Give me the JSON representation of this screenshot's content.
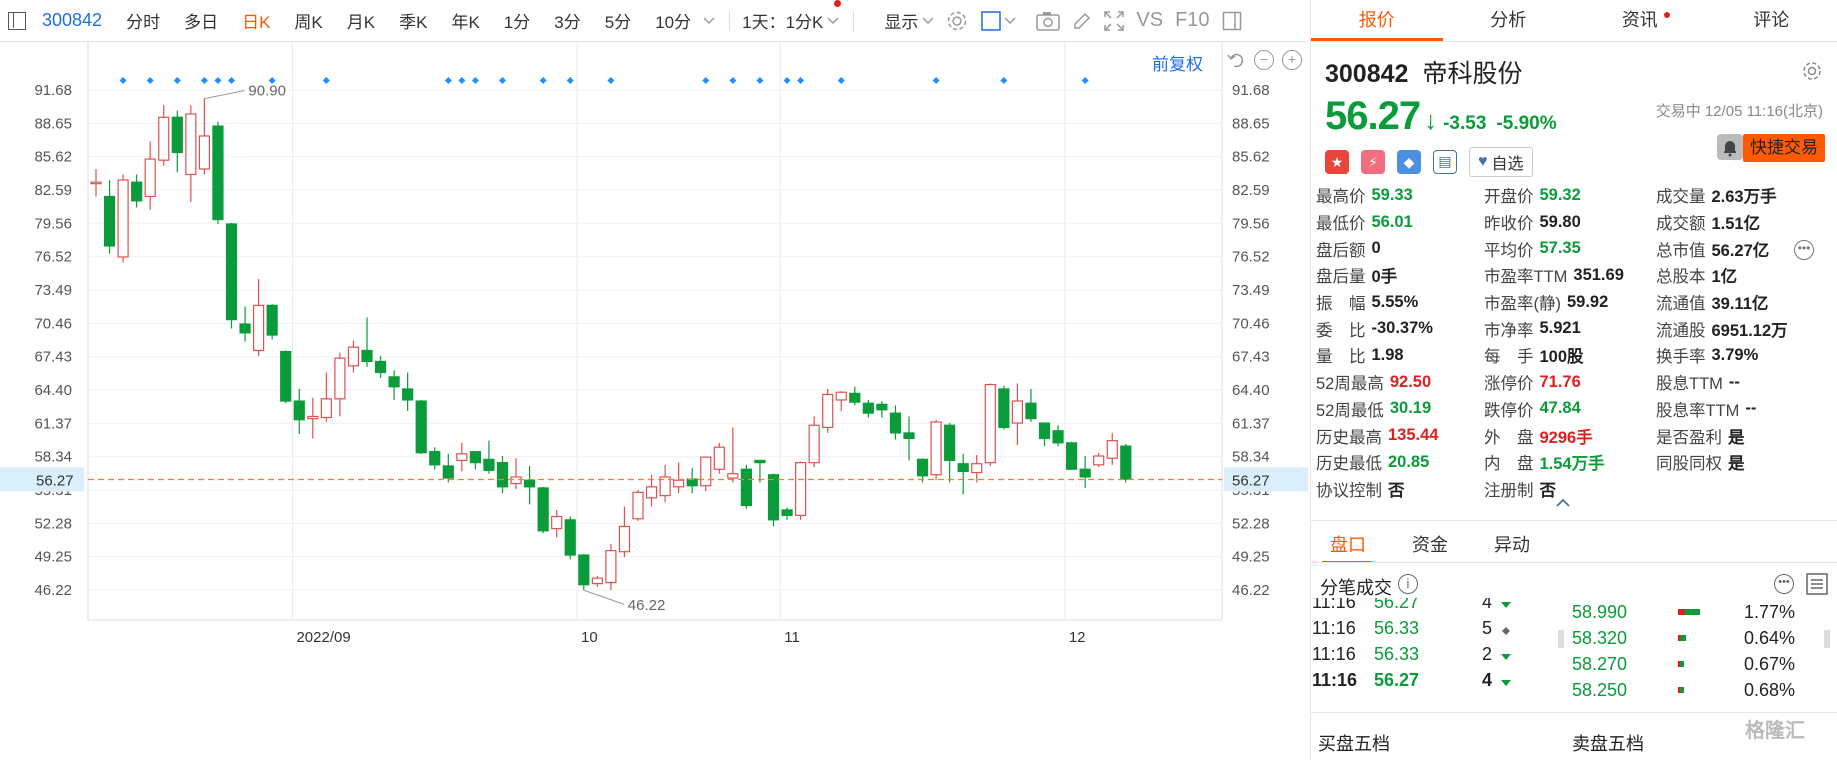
{
  "toolbar": {
    "code": "300842",
    "periods": [
      "分时",
      "多日",
      "日K",
      "周K",
      "月K",
      "季K",
      "年K",
      "1分",
      "3分",
      "5分",
      "10分"
    ],
    "active_period": "日K",
    "timeframe_select": "1天：1分K",
    "display_label": "显示",
    "vs_label": "VS",
    "f10_label": "F10"
  },
  "chart": {
    "fq_label": "前复权",
    "current_price_tag": "56.27",
    "high_label": "90.90",
    "low_label": "46.22",
    "colors": {
      "up": "#e05050",
      "down": "#0a9b3a",
      "price_line": "#ff7b2e",
      "marker": "#1e90ff"
    }
  },
  "chart_data": {
    "type": "candlestick",
    "y_ticks": [
      "91.68",
      "88.65",
      "85.62",
      "82.59",
      "79.56",
      "76.52",
      "73.49",
      "70.46",
      "67.43",
      "64.40",
      "61.37",
      "58.34",
      "55.31",
      "52.28",
      "49.25",
      "46.22"
    ],
    "ylim": [
      43.19,
      94.71
    ],
    "x_labels": [
      {
        "label": "2022/09",
        "index": 15
      },
      {
        "label": "10",
        "index": 36
      },
      {
        "label": "11",
        "index": 51
      },
      {
        "label": "12",
        "index": 72
      }
    ],
    "candles": [
      {
        "o": 83.3,
        "c": 83.3,
        "h": 84.5,
        "l": 82.0
      },
      {
        "o": 82.0,
        "c": 77.5,
        "h": 83.5,
        "l": 76.8
      },
      {
        "o": 76.5,
        "c": 83.5,
        "h": 84.0,
        "l": 76.0
      },
      {
        "o": 83.3,
        "c": 81.6,
        "h": 84.0,
        "l": 81.0
      },
      {
        "o": 82.0,
        "c": 85.4,
        "h": 87.0,
        "l": 80.8
      },
      {
        "o": 85.3,
        "c": 89.2,
        "h": 90.3,
        "l": 84.8
      },
      {
        "o": 89.2,
        "c": 86.0,
        "h": 89.8,
        "l": 84.2
      },
      {
        "o": 84.0,
        "c": 89.5,
        "h": 90.3,
        "l": 81.5
      },
      {
        "o": 84.5,
        "c": 87.5,
        "h": 90.9,
        "l": 84.0
      },
      {
        "o": 88.4,
        "c": 79.9,
        "h": 88.8,
        "l": 79.5
      },
      {
        "o": 79.5,
        "c": 70.8,
        "h": 79.6,
        "l": 70.0
      },
      {
        "o": 70.4,
        "c": 69.6,
        "h": 72.0,
        "l": 68.8
      },
      {
        "o": 68.0,
        "c": 72.1,
        "h": 74.5,
        "l": 67.5
      },
      {
        "o": 72.1,
        "c": 69.4,
        "h": 72.2,
        "l": 69.0
      },
      {
        "o": 67.9,
        "c": 63.4,
        "h": 68.0,
        "l": 63.2
      },
      {
        "o": 63.4,
        "c": 61.7,
        "h": 64.5,
        "l": 60.4
      },
      {
        "o": 61.8,
        "c": 62.0,
        "h": 63.7,
        "l": 60.0
      },
      {
        "o": 61.9,
        "c": 63.6,
        "h": 66.0,
        "l": 61.5
      },
      {
        "o": 63.6,
        "c": 67.3,
        "h": 67.8,
        "l": 62.0
      },
      {
        "o": 66.6,
        "c": 68.3,
        "h": 68.9,
        "l": 66.0
      },
      {
        "o": 68.0,
        "c": 67.0,
        "h": 71.0,
        "l": 66.5
      },
      {
        "o": 67.0,
        "c": 66.0,
        "h": 67.5,
        "l": 65.5
      },
      {
        "o": 65.6,
        "c": 64.7,
        "h": 66.2,
        "l": 63.5
      },
      {
        "o": 64.5,
        "c": 63.5,
        "h": 66.0,
        "l": 62.5
      },
      {
        "o": 63.4,
        "c": 58.7,
        "h": 63.5,
        "l": 58.6
      },
      {
        "o": 58.8,
        "c": 57.6,
        "h": 59.2,
        "l": 57.2
      },
      {
        "o": 57.5,
        "c": 56.4,
        "h": 58.6,
        "l": 56.0
      },
      {
        "o": 58.0,
        "c": 58.6,
        "h": 59.6,
        "l": 57.0
      },
      {
        "o": 58.8,
        "c": 57.8,
        "h": 58.7,
        "l": 57.2
      },
      {
        "o": 58.1,
        "c": 57.1,
        "h": 59.8,
        "l": 56.8
      },
      {
        "o": 57.8,
        "c": 55.6,
        "h": 58.4,
        "l": 55.0
      },
      {
        "o": 55.9,
        "c": 56.5,
        "h": 58.2,
        "l": 55.4
      },
      {
        "o": 56.2,
        "c": 55.6,
        "h": 57.5,
        "l": 54.0
      },
      {
        "o": 55.5,
        "c": 51.6,
        "h": 55.6,
        "l": 51.4
      },
      {
        "o": 51.8,
        "c": 52.9,
        "h": 53.5,
        "l": 51.0
      },
      {
        "o": 52.6,
        "c": 49.4,
        "h": 52.9,
        "l": 49.0
      },
      {
        "o": 49.4,
        "c": 46.7,
        "h": 49.5,
        "l": 46.2
      },
      {
        "o": 46.8,
        "c": 47.3,
        "h": 47.5,
        "l": 46.5
      },
      {
        "o": 46.9,
        "c": 49.8,
        "h": 50.4,
        "l": 46.2
      },
      {
        "o": 49.7,
        "c": 52.0,
        "h": 53.8,
        "l": 49.2
      },
      {
        "o": 52.7,
        "c": 55.1,
        "h": 55.3,
        "l": 52.5
      },
      {
        "o": 54.6,
        "c": 55.6,
        "h": 56.7,
        "l": 53.8
      },
      {
        "o": 54.8,
        "c": 56.5,
        "h": 57.6,
        "l": 54.2
      },
      {
        "o": 55.6,
        "c": 56.2,
        "h": 57.8,
        "l": 55.0
      },
      {
        "o": 56.3,
        "c": 55.7,
        "h": 57.3,
        "l": 55.0
      },
      {
        "o": 55.7,
        "c": 58.3,
        "h": 58.3,
        "l": 55.2
      },
      {
        "o": 57.2,
        "c": 59.2,
        "h": 59.6,
        "l": 56.8
      },
      {
        "o": 56.4,
        "c": 56.8,
        "h": 61.0,
        "l": 56.0
      },
      {
        "o": 57.2,
        "c": 53.9,
        "h": 57.6,
        "l": 53.6
      },
      {
        "o": 58.0,
        "c": 57.8,
        "h": 58.0,
        "l": 56.0
      },
      {
        "o": 56.7,
        "c": 52.6,
        "h": 56.8,
        "l": 52.0
      },
      {
        "o": 53.5,
        "c": 53.0,
        "h": 53.7,
        "l": 52.6
      },
      {
        "o": 53.0,
        "c": 57.8,
        "h": 57.9,
        "l": 52.6
      },
      {
        "o": 57.8,
        "c": 61.2,
        "h": 62.0,
        "l": 57.4
      },
      {
        "o": 61.0,
        "c": 64.0,
        "h": 64.5,
        "l": 60.5
      },
      {
        "o": 63.5,
        "c": 64.2,
        "h": 64.3,
        "l": 62.5
      },
      {
        "o": 64.1,
        "c": 63.3,
        "h": 64.7,
        "l": 63.0
      },
      {
        "o": 63.2,
        "c": 62.3,
        "h": 63.5,
        "l": 61.9
      },
      {
        "o": 63.1,
        "c": 62.6,
        "h": 63.4,
        "l": 61.9
      },
      {
        "o": 62.3,
        "c": 60.5,
        "h": 63.0,
        "l": 59.9
      },
      {
        "o": 60.5,
        "c": 60.0,
        "h": 62.0,
        "l": 58.0
      },
      {
        "o": 58.1,
        "c": 56.6,
        "h": 58.2,
        "l": 56.0
      },
      {
        "o": 56.7,
        "c": 61.5,
        "h": 61.7,
        "l": 56.2
      },
      {
        "o": 61.2,
        "c": 58.0,
        "h": 61.4,
        "l": 56.0
      },
      {
        "o": 57.7,
        "c": 57.0,
        "h": 58.6,
        "l": 54.9
      },
      {
        "o": 56.9,
        "c": 57.7,
        "h": 58.5,
        "l": 56.0
      },
      {
        "o": 57.8,
        "c": 64.9,
        "h": 65.0,
        "l": 57.5
      },
      {
        "o": 64.5,
        "c": 61.0,
        "h": 64.8,
        "l": 60.8
      },
      {
        "o": 61.4,
        "c": 63.4,
        "h": 65.0,
        "l": 59.4
      },
      {
        "o": 63.2,
        "c": 61.8,
        "h": 64.5,
        "l": 61.5
      },
      {
        "o": 61.4,
        "c": 60.0,
        "h": 61.4,
        "l": 59.3
      },
      {
        "o": 60.7,
        "c": 59.6,
        "h": 61.2,
        "l": 59.3
      },
      {
        "o": 59.6,
        "c": 57.2,
        "h": 59.7,
        "l": 57.2
      },
      {
        "o": 57.2,
        "c": 56.5,
        "h": 58.4,
        "l": 55.5
      },
      {
        "o": 57.6,
        "c": 58.4,
        "h": 58.7,
        "l": 57.4
      },
      {
        "o": 58.2,
        "c": 59.8,
        "h": 60.5,
        "l": 57.6
      },
      {
        "o": 59.3,
        "c": 56.3,
        "h": 59.5,
        "l": 56.0
      }
    ],
    "markers_at_index": [
      2,
      4,
      6,
      8,
      9,
      10,
      13,
      17,
      26,
      27,
      28,
      30,
      33,
      35,
      38,
      45,
      47,
      49,
      51,
      52,
      55,
      62,
      67,
      73
    ]
  },
  "quote": {
    "tabs": [
      "报价",
      "分析",
      "资讯",
      "评论"
    ],
    "active_tab": "报价",
    "code": "300842",
    "name": "帝科股份",
    "price": "56.27",
    "change": "-3.53",
    "change_pct": "-5.90%",
    "status": "交易中 12/05 11:16(北京)",
    "watch_label": "自选",
    "quick_trade": "快捷交易",
    "badge_icons": [
      "china-flag-icon",
      "flash-icon",
      "tag-icon",
      "news-icon"
    ]
  },
  "stats": {
    "col1": [
      {
        "label": "最高价",
        "value": "59.33",
        "color": "g"
      },
      {
        "label": "最低价",
        "value": "56.01",
        "color": "g"
      },
      {
        "label": "盘后额",
        "value": "0",
        "color": "k"
      },
      {
        "label": "盘后量",
        "value": "0手",
        "color": "k"
      },
      {
        "label": "振　幅",
        "value": "5.55%",
        "color": "k"
      },
      {
        "label": "委　比",
        "value": "-30.37%",
        "color": "k"
      },
      {
        "label": "量　比",
        "value": "1.98",
        "color": "k"
      },
      {
        "label": "52周最高",
        "value": "92.50",
        "color": "r"
      },
      {
        "label": "52周最低",
        "value": "30.19",
        "color": "g"
      },
      {
        "label": "历史最高",
        "value": "135.44",
        "color": "r"
      },
      {
        "label": "历史最低",
        "value": "20.85",
        "color": "g"
      },
      {
        "label": "协议控制",
        "value": "否",
        "color": "k"
      }
    ],
    "col2": [
      {
        "label": "开盘价",
        "value": "59.32",
        "color": "g"
      },
      {
        "label": "昨收价",
        "value": "59.80",
        "color": "k"
      },
      {
        "label": "平均价",
        "value": "57.35",
        "color": "g"
      },
      {
        "label": "市盈率TTM",
        "value": "351.69",
        "color": "k"
      },
      {
        "label": "市盈率(静)",
        "value": "59.92",
        "color": "k"
      },
      {
        "label": "市净率",
        "value": "5.921",
        "color": "k"
      },
      {
        "label": "每　手",
        "value": "100股",
        "color": "k"
      },
      {
        "label": "涨停价",
        "value": "71.76",
        "color": "r"
      },
      {
        "label": "跌停价",
        "value": "47.84",
        "color": "g"
      },
      {
        "label": "外　盘",
        "value": "9296手",
        "color": "r"
      },
      {
        "label": "内　盘",
        "value": "1.54万手",
        "color": "g"
      },
      {
        "label": "注册制",
        "value": "否",
        "color": "k"
      }
    ],
    "col3": [
      {
        "label": "成交量",
        "value": "2.63万手",
        "color": "k"
      },
      {
        "label": "成交额",
        "value": "1.51亿",
        "color": "k"
      },
      {
        "label": "总市值",
        "value": "56.27亿",
        "color": "k"
      },
      {
        "label": "总股本",
        "value": "1亿",
        "color": "k"
      },
      {
        "label": "流通值",
        "value": "39.11亿",
        "color": "k"
      },
      {
        "label": "流通股",
        "value": "6951.12万",
        "color": "k"
      },
      {
        "label": "换手率",
        "value": "3.79%",
        "color": "k"
      },
      {
        "label": "股息TTM",
        "value": "--",
        "color": "k"
      },
      {
        "label": "股息率TTM",
        "value": "--",
        "color": "k"
      },
      {
        "label": "是否盈利",
        "value": "是",
        "color": "k"
      },
      {
        "label": "同股同权",
        "value": "是",
        "color": "k"
      }
    ]
  },
  "trading": {
    "sub_tabs": [
      "盘口",
      "资金",
      "异动"
    ],
    "active_sub_tab": "盘口",
    "ticks_title": "分笔成交",
    "ticks": [
      {
        "time": "11:16",
        "price": "56.27",
        "vol": "4",
        "dir": "down"
      },
      {
        "time": "11:16",
        "price": "56.33",
        "vol": "5",
        "dir": "flat"
      },
      {
        "time": "11:16",
        "price": "56.33",
        "vol": "2",
        "dir": "down"
      },
      {
        "time": "11:16",
        "price": "56.27",
        "vol": "4",
        "dir": "down"
      }
    ],
    "depth": [
      {
        "price": "58.990",
        "pct": "1.77%"
      },
      {
        "price": "58.320",
        "pct": "0.64%"
      },
      {
        "price": "58.270",
        "pct": "0.67%"
      },
      {
        "price": "58.250",
        "pct": "0.68%"
      }
    ],
    "buy5_label": "买盘五档",
    "sell5_label": "卖盘五档",
    "watermark": "格隆汇"
  }
}
